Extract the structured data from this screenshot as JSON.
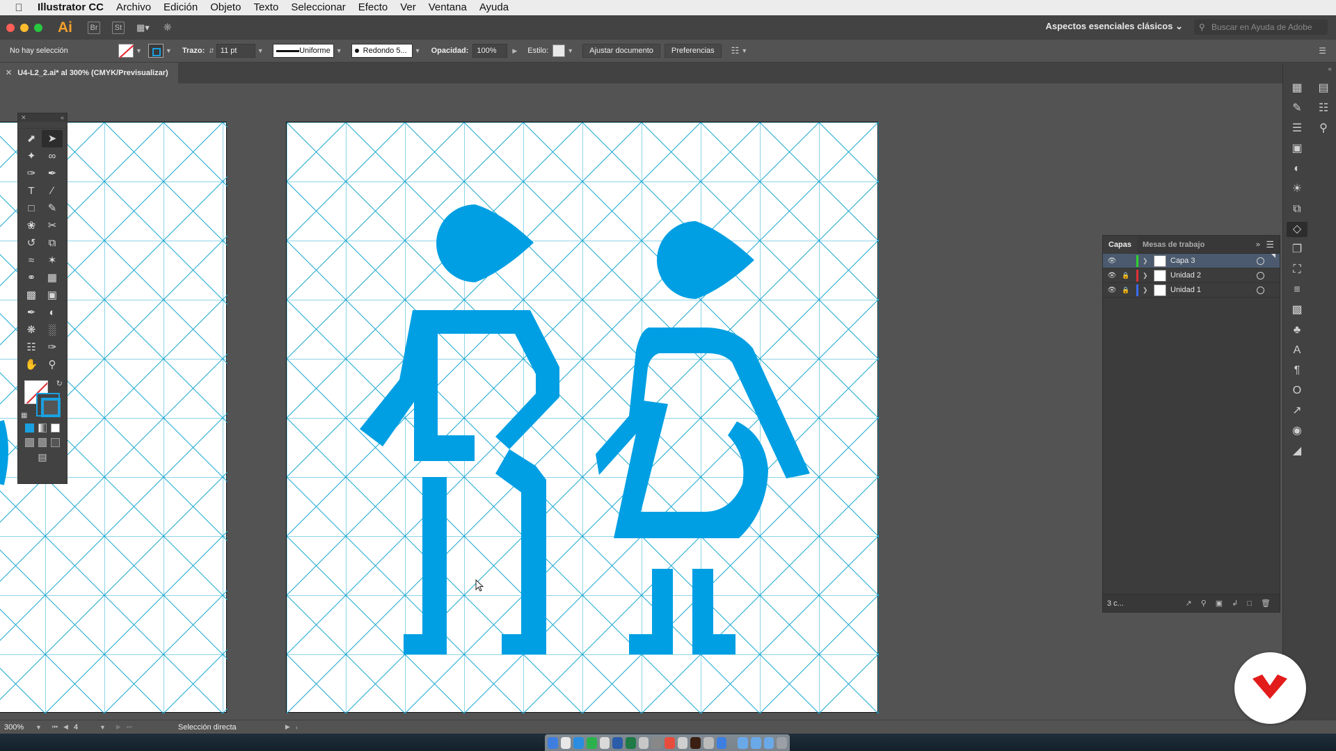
{
  "menubar": {
    "app_name": "Illustrator CC",
    "items": [
      "Archivo",
      "Edición",
      "Objeto",
      "Texto",
      "Seleccionar",
      "Efecto",
      "Ver",
      "Ventana",
      "Ayuda"
    ]
  },
  "appbar": {
    "logo": "Ai",
    "bridge": "Br",
    "stock": "St",
    "workspace": "Aspectos esenciales clásicos",
    "help_search_placeholder": "Buscar en Ayuda de Adobe"
  },
  "control": {
    "selection_status": "No hay selección",
    "stroke_label": "Trazo:",
    "stroke_weight": "11 pt",
    "stroke_profile": "Uniforme",
    "brush": "Redondo 5...",
    "opacity_label": "Opacidad:",
    "opacity": "100%",
    "style_label": "Estilo:",
    "ajustar_button": "Ajustar documento",
    "prefs_button": "Preferencias"
  },
  "document": {
    "tab_title": "U4-L2_2.ai* al 300% (CMYK/Previsualizar)"
  },
  "layers": {
    "tabs": [
      "Capas",
      "Mesas de trabajo"
    ],
    "rows": [
      {
        "name": "Capa 3",
        "color": "#2fd32f",
        "locked": false,
        "selected": true
      },
      {
        "name": "Unidad 2",
        "color": "#e0303a",
        "locked": true,
        "selected": false
      },
      {
        "name": "Unidad 1",
        "color": "#3c6cf0",
        "locked": true,
        "selected": false
      }
    ],
    "count": "3 c..."
  },
  "status": {
    "zoom": "300%",
    "artboard_number": "4",
    "tool_name": "Selección directa"
  },
  "colors": {
    "figure": "#009fe3",
    "grid": "#1aa7cf"
  }
}
